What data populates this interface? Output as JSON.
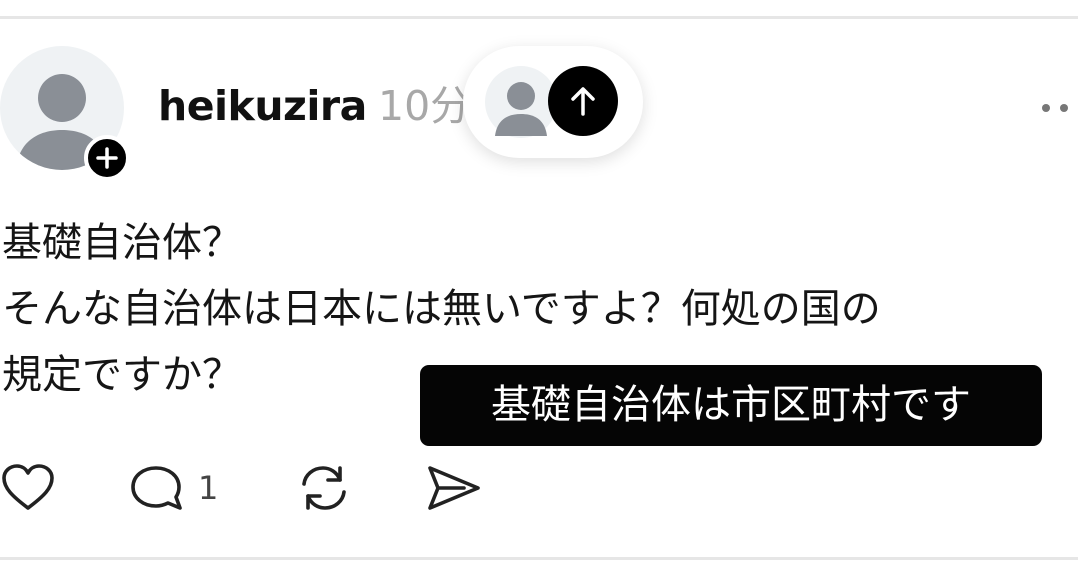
{
  "post": {
    "username": "heikuzira",
    "timestamp": "10分",
    "text_lines": [
      "基礎自治体？",
      "そんな自治体は日本には無いですよ？何処の国の",
      "規定ですか？"
    ],
    "caption_overlay": "基礎自治体は市区町村です"
  },
  "actions": {
    "like_icon": "heart-icon",
    "comment_icon": "comment-icon",
    "comment_count": "1",
    "repost_icon": "repost-icon",
    "share_icon": "share-icon"
  },
  "header_icons": {
    "follow_icon": "plus-icon",
    "reply_up_icon": "arrow-up-icon",
    "more_icon": "more-dots-icon"
  },
  "colors": {
    "text": "#151515",
    "muted": "#a8a8a8",
    "avatar_bg": "#eff2f4",
    "avatar_figure": "#8a8f96",
    "divider": "#e6e6e6",
    "caption_bg": "#050505"
  }
}
